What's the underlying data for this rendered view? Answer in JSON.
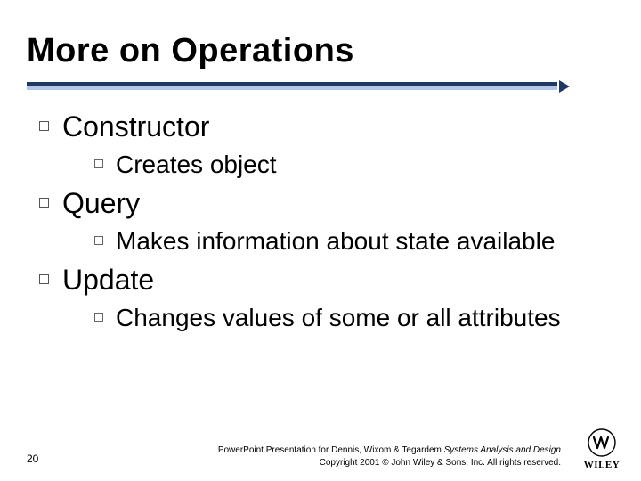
{
  "title": "More on Operations",
  "bullets": {
    "b1": {
      "label": "Constructor",
      "sub": "Creates object"
    },
    "b2": {
      "label": "Query",
      "sub": "Makes information about state available"
    },
    "b3": {
      "label": "Update",
      "sub": "Changes values of some or all attributes"
    }
  },
  "page_number": "20",
  "footer": {
    "line1_plain": "PowerPoint Presentation for Dennis, Wixom & Tegardem ",
    "line1_italic": "Systems Analysis and Design",
    "line2": "Copyright 2001 © John Wiley & Sons, Inc.  All rights reserved."
  },
  "logo": {
    "brand": "WILEY"
  }
}
